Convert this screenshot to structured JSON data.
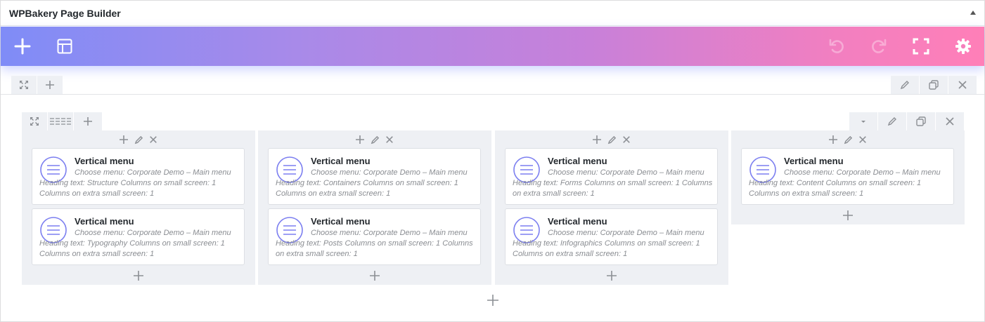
{
  "panel": {
    "title": "WPBakery Page Builder"
  },
  "navbar": {
    "add_element": "plus-icon",
    "templates": "layout-icon",
    "undo": "undo-icon",
    "redo": "redo-icon",
    "fullscreen": "fullscreen-icon",
    "settings": "gear-icon"
  },
  "colors": {
    "gradient_start": "#7f8cf7",
    "gradient_end": "#ff7fb8",
    "icon_accent": "#7c7ff0",
    "column_bg": "#eef0f4"
  },
  "columns": [
    {
      "elements": [
        {
          "title": "Vertical menu",
          "desc": "Choose menu: Corporate Demo – Main menu  Heading text: Structure  Columns on small screen: 1  Columns on extra small screen: 1"
        },
        {
          "title": "Vertical menu",
          "desc": "Choose menu: Corporate Demo – Main menu  Heading text: Typography  Columns on small screen: 1  Columns on extra small screen: 1"
        }
      ]
    },
    {
      "elements": [
        {
          "title": "Vertical menu",
          "desc": "Choose menu: Corporate Demo – Main menu  Heading text: Containers  Columns on small screen: 1  Columns on extra small screen: 1"
        },
        {
          "title": "Vertical menu",
          "desc": "Choose menu: Corporate Demo – Main menu  Heading text: Posts  Columns on small screen: 1  Columns on extra small screen: 1"
        }
      ]
    },
    {
      "elements": [
        {
          "title": "Vertical menu",
          "desc": "Choose menu: Corporate Demo – Main menu  Heading text: Forms  Columns on small screen: 1  Columns on extra small screen: 1"
        },
        {
          "title": "Vertical menu",
          "desc": "Choose menu: Corporate Demo – Main menu  Heading text: Infographics  Columns on small screen: 1  Columns on extra small screen: 1"
        }
      ]
    },
    {
      "elements": [
        {
          "title": "Vertical menu",
          "desc": "Choose menu: Corporate Demo – Main menu  Heading text: Content  Columns on small screen: 1  Columns on extra small screen: 1"
        }
      ]
    }
  ]
}
